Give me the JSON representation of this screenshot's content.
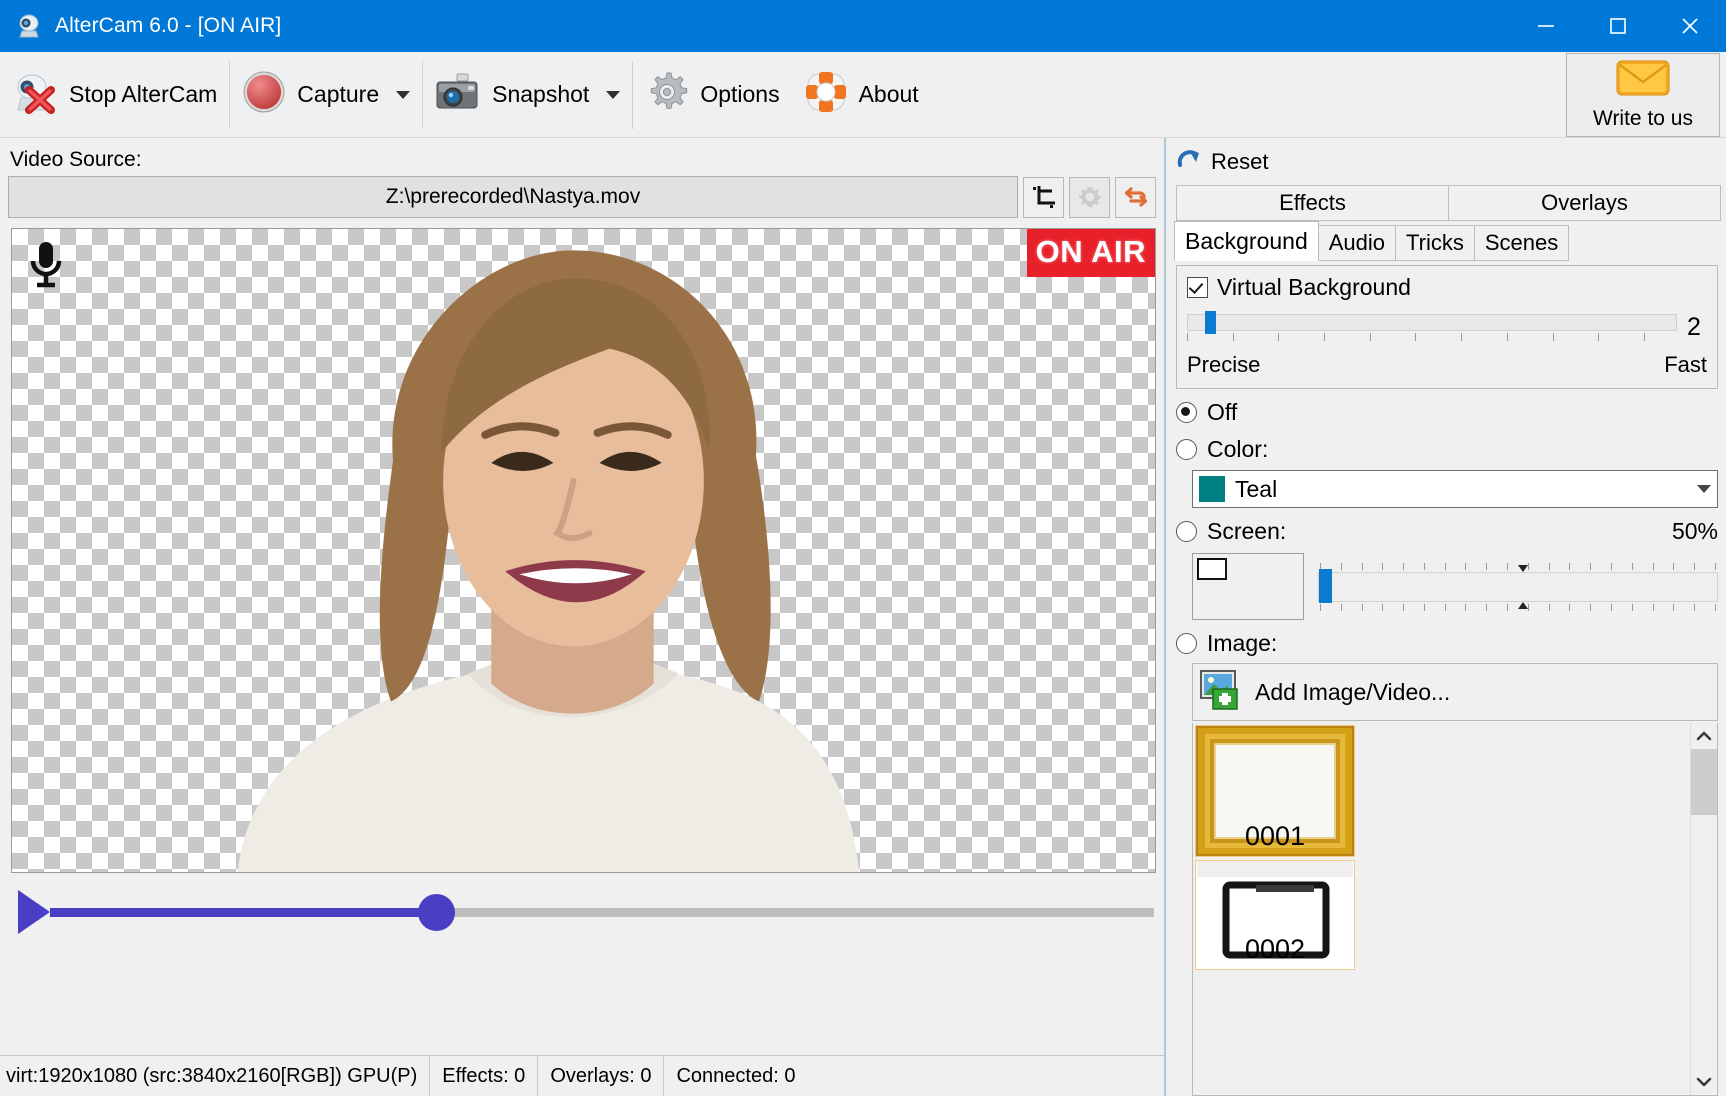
{
  "window": {
    "title": "AlterCam 6.0 - [ON AIR]",
    "icon": "webcam-icon",
    "minimize": "minimize-icon",
    "maximize": "maximize-icon",
    "close": "close-icon",
    "accent": "#0078d7"
  },
  "toolbar": {
    "stop_label": "Stop AlterCam",
    "capture_label": "Capture",
    "snapshot_label": "Snapshot",
    "options_label": "Options",
    "about_label": "About",
    "write_label": "Write to us"
  },
  "video_source": {
    "label": "Video Source:",
    "value": "Z:\\prerecorded\\Nastya.mov",
    "buttons": [
      "crop-icon",
      "gear-icon",
      "swap-icon"
    ]
  },
  "preview": {
    "on_air": "ON AIR",
    "mic": "microphone-icon",
    "on_air_color": "#e8202a"
  },
  "playback": {
    "play": "play-icon",
    "position_percent": 35
  },
  "status": {
    "resolution": "virt:1920x1080 (src:3840x2160[RGB]) GPU(P)",
    "effects": "Effects: 0",
    "overlays": "Overlays: 0",
    "connected": "Connected: 0"
  },
  "panel": {
    "reset_label": "Reset",
    "reset_icon": "reset-icon",
    "tabs_top": [
      "Effects",
      "Overlays"
    ],
    "tabs_bottom": [
      "Background",
      "Audio",
      "Tricks",
      "Scenes"
    ],
    "active_tab": "Background",
    "virtual_background": {
      "checkbox_label": "Virtual Background",
      "checked": true,
      "value": "2",
      "slider_percent": 3.5,
      "left_label": "Precise",
      "right_label": "Fast"
    },
    "modes": {
      "off_label": "Off",
      "off_selected": true,
      "color_label": "Color:",
      "color_selected": false,
      "color_value": "Teal",
      "color_hex": "#008080",
      "screen_label": "Screen:",
      "screen_selected": false,
      "screen_opacity": "50%",
      "screen_slider_percent": 0,
      "image_label": "Image:",
      "image_selected": false
    },
    "image_section": {
      "add_label": "Add Image/Video...",
      "add_icon": "add-image-icon",
      "thumbnails": [
        {
          "caption": "0001",
          "kind": "gold-frame"
        },
        {
          "caption": "0002",
          "kind": "laptop"
        }
      ],
      "scroll_up_icon": "chevron-up-icon",
      "scroll_down_icon": "chevron-down-icon"
    }
  }
}
